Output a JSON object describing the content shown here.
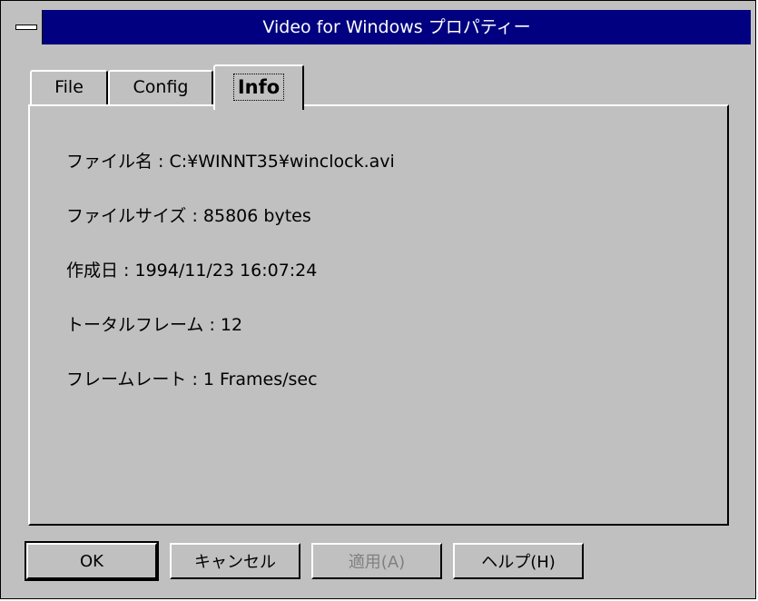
{
  "window": {
    "title": "Video for Windows プロパティー"
  },
  "tabs": [
    {
      "label": "File"
    },
    {
      "label": "Config"
    },
    {
      "label": "Info",
      "selected": true
    }
  ],
  "info": {
    "file_name": "ファイル名 : C:¥WINNT35¥winclock.avi",
    "file_size": "ファイルサイズ : 85806 bytes",
    "created": "作成日 : 1994/11/23 16:07:24",
    "total_frames": "トータルフレーム : 12",
    "frame_rate": "フレームレート : 1 Frames/sec"
  },
  "buttons": {
    "ok": "OK",
    "cancel": "キャンセル",
    "apply": "適用(A)",
    "help": "ヘルプ(H)"
  }
}
